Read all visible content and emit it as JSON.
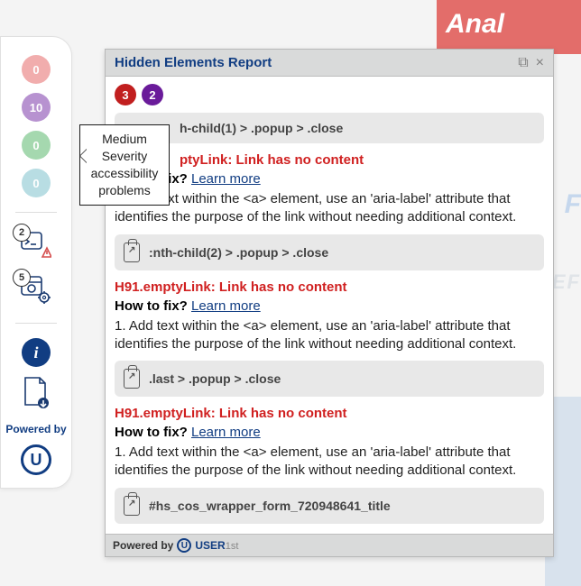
{
  "bg": {
    "banner": "Anal",
    "text1": "F",
    "text2": "EF"
  },
  "sidebar": {
    "badges": [
      {
        "count": "0"
      },
      {
        "count": "10"
      },
      {
        "count": "0"
      },
      {
        "count": "0"
      }
    ],
    "tool1_count": "2",
    "tool2_count": "5",
    "info_glyph": "i",
    "powered_label": "Powered by",
    "logo_glyph": "U"
  },
  "tooltip": {
    "line1": "Medium",
    "line2": "Severity",
    "line3": "accessibility",
    "line4": "problems"
  },
  "panel": {
    "title": "Hidden Elements Report",
    "popout_glyph": "⧉",
    "close_glyph": "×",
    "count_red": "3",
    "count_purple": "2",
    "issues": [
      {
        "selector": ":nth-child(1) > .popup > .close",
        "selector_partial": "h-child(1) > .popup > .close",
        "title": "ptyLink: Link has no content",
        "fix_label": "How to fix?",
        "learn_more": "Learn more",
        "desc": "1. Add text within the <a> element, use an 'aria-label' attribute that identifies the purpose of the link without needing additional context."
      },
      {
        "selector": ":nth-child(2) > .popup > .close",
        "title": "H91.emptyLink: Link has no content",
        "fix_label": "How to fix?",
        "learn_more": "Learn more",
        "desc": "1. Add text within the <a> element, use an 'aria-label' attribute that identifies the purpose of the link without needing additional context."
      },
      {
        "selector": ".last > .popup > .close",
        "title": "H91.emptyLink: Link has no content",
        "fix_label": "How to fix?",
        "learn_more": "Learn more",
        "desc": "1. Add text within the <a> element, use an 'aria-label' attribute that identifies the purpose of the link without needing additional context."
      },
      {
        "selector": "#hs_cos_wrapper_form_720948641_title"
      }
    ],
    "footer": {
      "powered": "Powered by",
      "brand_u": "USER",
      "brand_tail": "1st",
      "u_glyph": "U"
    }
  }
}
